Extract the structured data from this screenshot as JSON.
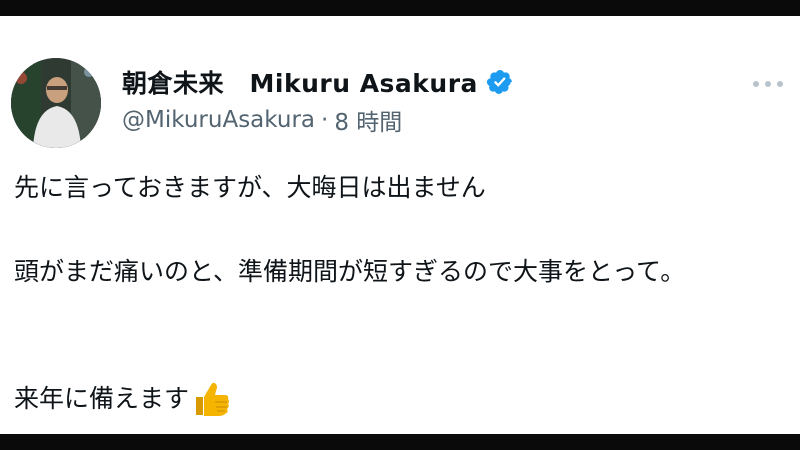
{
  "tweet": {
    "author": {
      "display_name": "朝倉未来　Mikuru Asakura",
      "verified": true,
      "handle": "@MikuruAsakura",
      "separator": "·",
      "time": "8 時間"
    },
    "body": {
      "paragraph_1": "先に言っておきますが、大晦日は出ません",
      "paragraph_2": "頭がまだ痛いのと、準備期間が短すぎるので大事をとって。",
      "paragraph_3": "来年に備えます"
    },
    "icons": {
      "verified": "verified-badge-icon",
      "more": "more-options-icon",
      "emoji": "thumbs-up-emoji-icon"
    },
    "colors": {
      "verified": "#1d9bf0",
      "secondary_text": "#536471",
      "primary_text": "#0f1419",
      "thumbs_up": "#f4b400"
    }
  }
}
